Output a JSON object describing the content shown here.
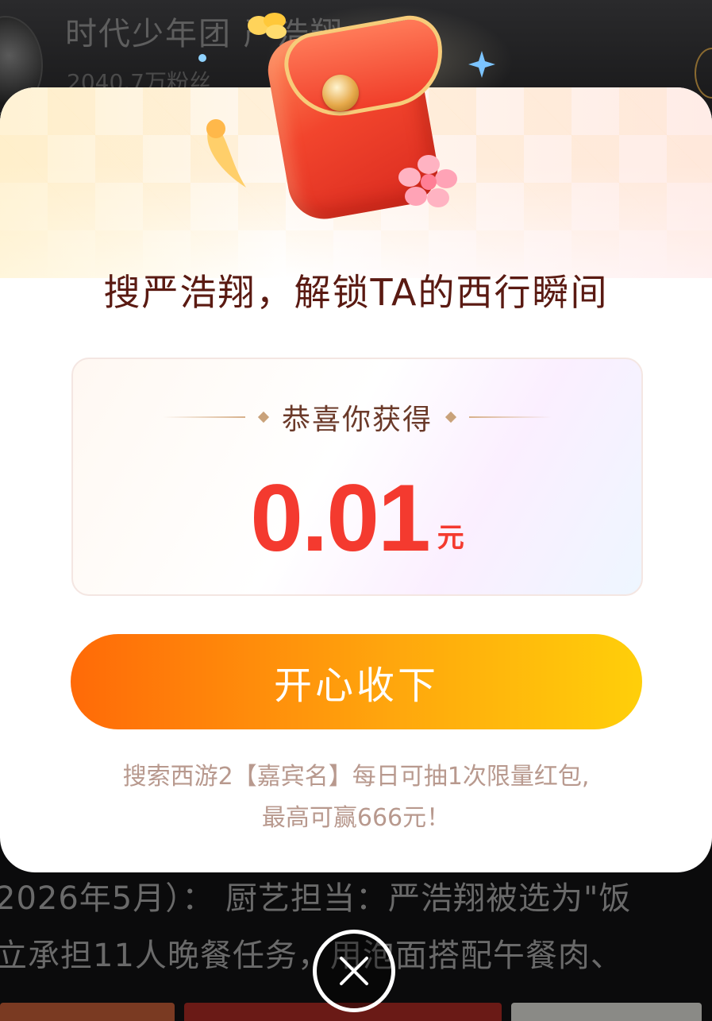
{
  "background": {
    "profile_title": "时代少年团 严浩翔",
    "fans_text": "2040.7万粉丝",
    "text_line_1": "2026年5月）： 厨艺担当：严浩翔被选为\"饭",
    "text_line_2": "立承担11人晚餐任务，用泡面搭配午餐肉、"
  },
  "modal": {
    "headline": "搜严浩翔，解锁TA的西行瞬间",
    "congrats_label": "恭喜你获得",
    "amount": "0.01",
    "unit": "元",
    "accept_button_label": "开心收下",
    "footnote_line_1": "搜索西游2【嘉宾名】每日可抽1次限量红包,",
    "footnote_line_2": "最高可赢666元！"
  },
  "colors": {
    "headline": "#5a1a12",
    "amount": "#f43a2f",
    "button_start": "#ff6a08",
    "button_end": "#ffcf0a",
    "footnote": "#b8998e"
  },
  "icons": {
    "close": "close-icon",
    "envelope": "red-envelope-icon"
  }
}
